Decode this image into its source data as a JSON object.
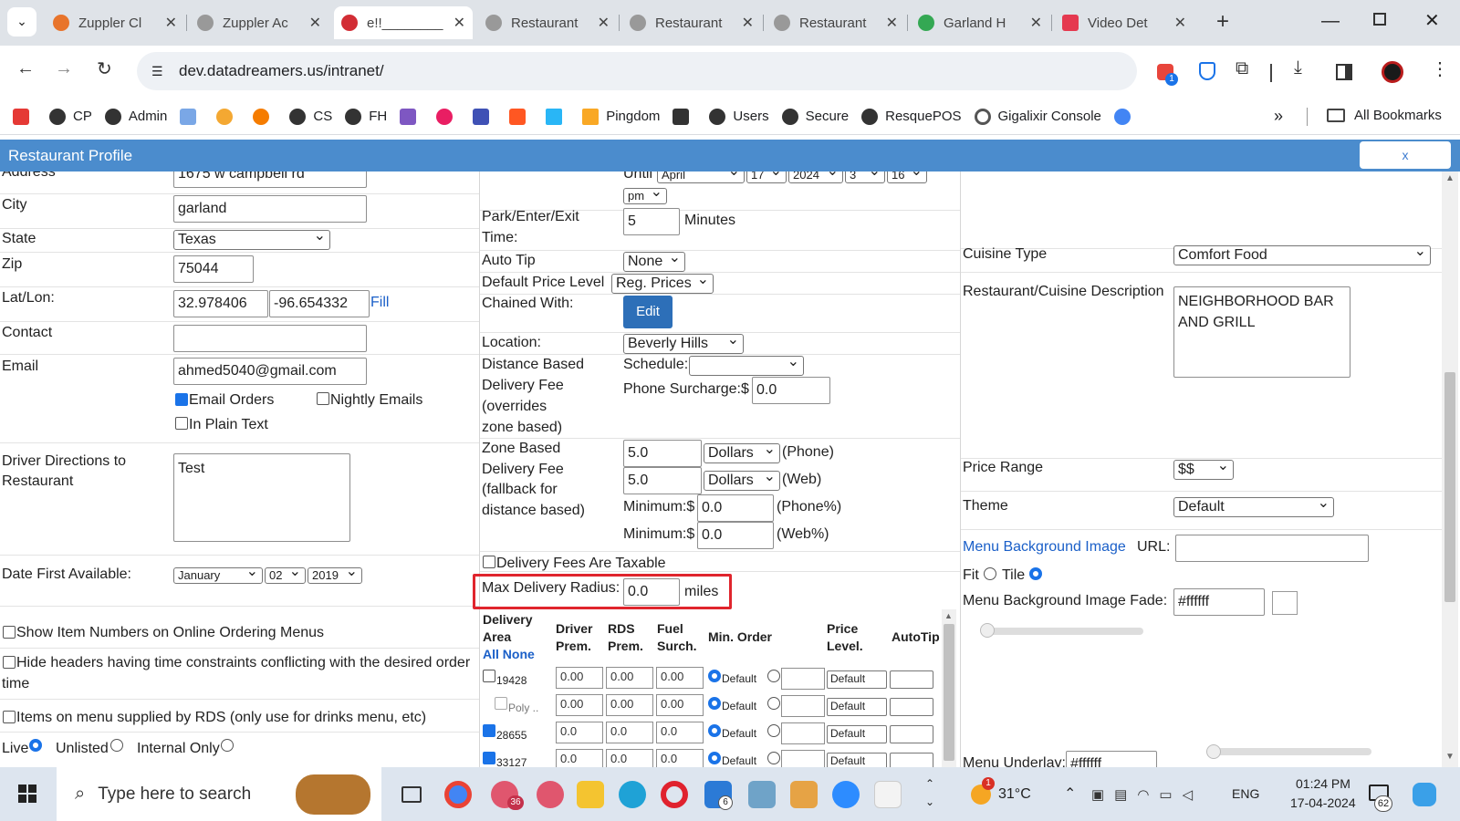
{
  "browser": {
    "tabs": [
      {
        "title": "Zuppler Cl",
        "icon_color": "#e8742b"
      },
      {
        "title": "Zuppler Ac",
        "icon_color": "#8a8a8a"
      },
      {
        "title": "e!!________",
        "icon_color": "#d22d35"
      },
      {
        "title": "Restaurant",
        "icon_color": "#8a8a8a"
      },
      {
        "title": "Restaurant",
        "icon_color": "#8a8a8a"
      },
      {
        "title": "Restaurant",
        "icon_color": "#8a8a8a"
      },
      {
        "title": "Garland H",
        "icon_color": "#34a853"
      },
      {
        "title": "Video Det",
        "icon_color": "#e53950"
      }
    ],
    "close_glyph": "✕",
    "new_tab_glyph": "+",
    "url": "dev.datadreamers.us/intranet/",
    "bookmarks": [
      "CP",
      "Admin",
      "CS",
      "FH",
      "Pingdom",
      "Users",
      "Secure",
      "ResquePOS",
      "Gigalixir Console"
    ],
    "all_bookmarks": "All Bookmarks",
    "extension_badge": "1"
  },
  "modal": {
    "title": "Restaurant Profile",
    "close_label": "x"
  },
  "left": {
    "address_label": "Address",
    "address_value": "1675 w campbell rd",
    "city_label": "City",
    "city_value": "garland",
    "state_label": "State",
    "state_value": "Texas",
    "zip_label": "Zip",
    "zip_value": "75044",
    "latlon_label": "Lat/Lon:",
    "lat_value": "32.978406",
    "lon_value": "-96.654332",
    "fill_label": "Fill",
    "contact_label": "Contact",
    "contact_value": "",
    "email_label": "Email",
    "email_value": "ahmed5040@gmail.com",
    "email_orders_label": "Email Orders",
    "nightly_emails_label": "Nightly Emails",
    "plain_text_label": "In Plain Text",
    "driver_dir_label_1": "Driver Directions to",
    "driver_dir_label_2": "Restaurant",
    "driver_dir_value": "Test",
    "date_first_label": "Date First Available:",
    "date_month": "January",
    "date_day": "02",
    "date_year": "2019",
    "show_item_numbers": "Show Item Numbers on Online Ordering Menus",
    "hide_headers_1": "Hide headers having time constraints conflicting with the desired order",
    "hide_headers_2": "time",
    "items_rds": "Items on menu supplied by RDS (only use for drinks menu, etc)",
    "live_label": "Live",
    "unlisted_label": "Unlisted",
    "internal_label": "Internal Only"
  },
  "middle": {
    "until_label": "Until",
    "until_month": "April",
    "until_day": "17",
    "until_year": "2024",
    "until_hour": "3",
    "until_min": "16",
    "until_ampm": "pm",
    "park_label_1": "Park/Enter/Exit",
    "park_label_2": "Time:",
    "park_value": "5",
    "minutes_label": "Minutes",
    "auto_tip_label": "Auto Tip",
    "auto_tip_value": "None",
    "price_level_label": "Default Price Level",
    "price_level_value": "Reg. Prices",
    "chained_label": "Chained With:",
    "edit_label": "Edit",
    "location_label": "Location:",
    "location_value": "Beverly Hills",
    "dist_fee_1": "Distance Based",
    "dist_fee_2": "Delivery Fee",
    "dist_fee_3": "(overrides",
    "dist_fee_4": "zone based)",
    "schedule_label": "Schedule:",
    "schedule_value": "",
    "phone_surcharge_label": "Phone Surcharge:$",
    "phone_surcharge_value": "0.0",
    "zone_fee_1": "Zone Based",
    "zone_fee_2": "Delivery Fee",
    "zone_fee_3": "(fallback for",
    "zone_fee_4": "distance based)",
    "zone_phone_value": "5.0",
    "zone_phone_unit": "Dollars",
    "zone_phone_label": "(Phone)",
    "zone_web_value": "5.0",
    "zone_web_unit": "Dollars",
    "zone_web_label": "(Web)",
    "minimum_label": "Minimum:$",
    "min_phone_value": "0.0",
    "min_phone_label": "(Phone%)",
    "min_web_value": "0.0",
    "min_web_label": "(Web%)",
    "taxable_label": "Delivery Fees Are Taxable",
    "max_radius_label": "Max Delivery Radius:",
    "max_radius_value": "0.0",
    "miles_label": "miles",
    "table_headers": {
      "area_1": "Delivery",
      "area_2": "Area",
      "all": "All",
      "none": "None",
      "driver_1": "Driver",
      "driver_2": "Prem.",
      "rds_1": "RDS",
      "rds_2": "Prem.",
      "fuel_1": "Fuel",
      "fuel_2": "Surch.",
      "min_order": "Min. Order",
      "price_1": "Price",
      "price_2": "Level.",
      "autotip": "AutoTip"
    },
    "rows": [
      {
        "area": "19428",
        "driver": "0.00",
        "rds": "0.00",
        "fuel": "0.00",
        "default_label": "Default",
        "price": "Default",
        "checked": false
      },
      {
        "area": "Poly ..",
        "driver": "0.00",
        "rds": "0.00",
        "fuel": "0.00",
        "default_label": "Default",
        "price": "Default",
        "checked": false
      },
      {
        "area": "28655",
        "driver": "0.0",
        "rds": "0.0",
        "fuel": "0.0",
        "default_label": "Default",
        "price": "Default",
        "checked": true
      },
      {
        "area": "33127",
        "driver": "0.0",
        "rds": "0.0",
        "fuel": "0.0",
        "default_label": "Default",
        "price": "Default",
        "checked": true
      }
    ]
  },
  "right": {
    "cuisine_label": "Cuisine Type",
    "cuisine_value": "Comfort Food",
    "desc_label": "Restaurant/Cuisine Description",
    "desc_value_1": "NEIGHBORHOOD BAR",
    "desc_value_2": "AND GRILL",
    "price_range_label": "Price Range",
    "price_range_value": "$$",
    "theme_label": "Theme",
    "theme_value": "Default",
    "menu_bg_label": "Menu Background Image",
    "url_label": "URL:",
    "url_value": "",
    "fit_label": "Fit",
    "tile_label": "Tile",
    "fade_label": "Menu Background Image Fade:",
    "fade_value": "#ffffff",
    "underlay_label": "Menu Underlay:",
    "underlay_value": "#ffffff"
  },
  "taskbar": {
    "search_placeholder": "Type here to search",
    "weather": "31°C",
    "lang": "ENG",
    "time": "01:24 PM",
    "date": "17-04-2024",
    "notif_count": "62",
    "teams_badge": "36",
    "todo_badge": "6",
    "weather_badge": "1"
  }
}
